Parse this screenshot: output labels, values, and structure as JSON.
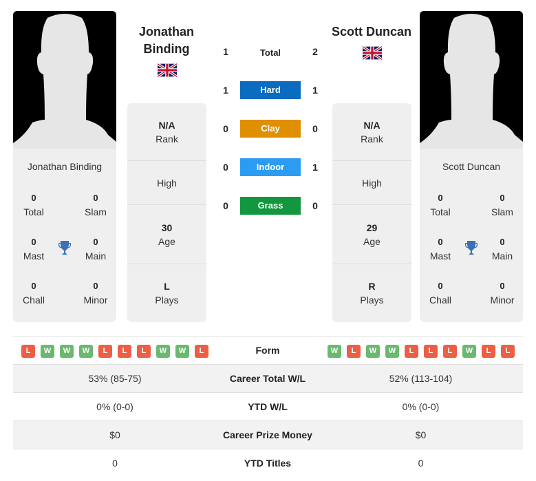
{
  "colors": {
    "hard": "#0b6bbf",
    "clay": "#df8f00",
    "indoor": "#2b9cf2",
    "grass": "#12963e",
    "win": "#6ab96f",
    "loss": "#ec5f45",
    "trophy": "#3b6fb6"
  },
  "players": {
    "left": {
      "name_line1": "Jonathan",
      "name_line2": "Binding",
      "full_name": "Jonathan Binding",
      "flag": "uk-flag",
      "titles": {
        "total": "0",
        "total_label": "Total",
        "slam": "0",
        "slam_label": "Slam",
        "mast": "0",
        "mast_label": "Mast",
        "main": "0",
        "main_label": "Main",
        "chall": "0",
        "chall_label": "Chall",
        "minor": "0",
        "minor_label": "Minor"
      },
      "info": {
        "rank": "N/A",
        "rank_label": "Rank",
        "high_label": "High",
        "age": "30",
        "age_label": "Age",
        "plays": "L",
        "plays_label": "Plays"
      },
      "form": [
        "L",
        "W",
        "W",
        "W",
        "L",
        "L",
        "L",
        "W",
        "W",
        "L"
      ]
    },
    "right": {
      "name_line1": "Scott Duncan",
      "full_name": "Scott Duncan",
      "flag": "uk-flag",
      "titles": {
        "total": "0",
        "total_label": "Total",
        "slam": "0",
        "slam_label": "Slam",
        "mast": "0",
        "mast_label": "Mast",
        "main": "0",
        "main_label": "Main",
        "chall": "0",
        "chall_label": "Chall",
        "minor": "0",
        "minor_label": "Minor"
      },
      "info": {
        "rank": "N/A",
        "rank_label": "Rank",
        "high_label": "High",
        "age": "29",
        "age_label": "Age",
        "plays": "R",
        "plays_label": "Plays"
      },
      "form": [
        "W",
        "L",
        "W",
        "W",
        "L",
        "L",
        "L",
        "W",
        "L",
        "L"
      ]
    }
  },
  "h2h": {
    "total": {
      "label": "Total",
      "left": "1",
      "right": "2"
    },
    "surfaces": [
      {
        "label": "Hard",
        "left": "1",
        "right": "1",
        "color_key": "hard"
      },
      {
        "label": "Clay",
        "left": "0",
        "right": "0",
        "color_key": "clay"
      },
      {
        "label": "Indoor",
        "left": "0",
        "right": "1",
        "color_key": "indoor"
      },
      {
        "label": "Grass",
        "left": "0",
        "right": "0",
        "color_key": "grass"
      }
    ]
  },
  "stats": {
    "form_label": "Form",
    "rows": [
      {
        "label": "Career Total W/L",
        "left": "53% (85-75)",
        "right": "52% (113-104)"
      },
      {
        "label": "YTD W/L",
        "left": "0% (0-0)",
        "right": "0% (0-0)"
      },
      {
        "label": "Career Prize Money",
        "left": "$0",
        "right": "$0"
      },
      {
        "label": "YTD Titles",
        "left": "0",
        "right": "0"
      }
    ]
  }
}
